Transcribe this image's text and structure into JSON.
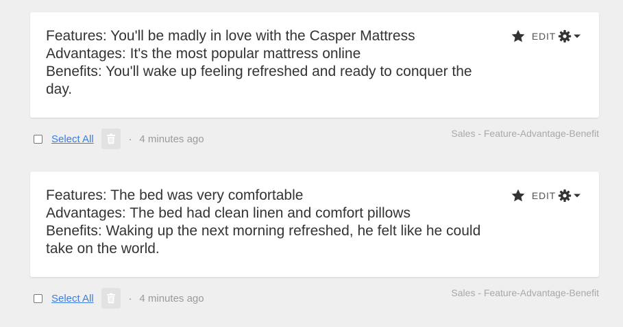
{
  "results": [
    {
      "lines": [
        "Features: You'll be madly in love with the Casper Mattress",
        "Advantages: It's the most popular mattress online",
        "Benefits: You'll wake up feeling refreshed and ready to conquer the day."
      ],
      "edit_label": "EDIT",
      "select_all_label": "Select All",
      "separator": "·",
      "timestamp": "4 minutes ago",
      "category": "Sales - Feature-Advantage-Benefit"
    },
    {
      "lines": [
        "Features: The bed was very comfortable",
        "Advantages: The bed had clean linen and comfort pillows",
        "Benefits: Waking up the next morning refreshed, he felt like he could take on the world."
      ],
      "edit_label": "EDIT",
      "select_all_label": "Select All",
      "separator": "·",
      "timestamp": "4 minutes ago",
      "category": "Sales - Feature-Advantage-Benefit"
    }
  ],
  "icons": {
    "star": "star-icon",
    "gear": "gear-icon",
    "caret": "caret-down-icon",
    "trash": "trash-icon"
  },
  "colors": {
    "background": "#efefef",
    "card": "#ffffff",
    "link": "#3b7ddd",
    "muted": "#a8a8a8"
  }
}
